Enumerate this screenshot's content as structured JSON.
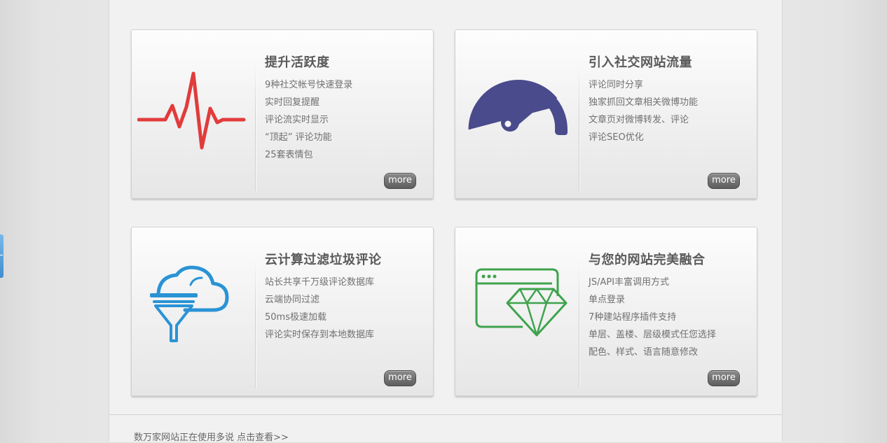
{
  "cards": [
    {
      "title": "提升活跃度",
      "items": [
        "9种社交帐号快速登录",
        "实时回复提醒",
        "评论流实时显示",
        "“顶起” 评论功能",
        "25套表情包"
      ],
      "more": "more",
      "icon": "heartbeat-icon",
      "icon_color": "#e23b3b"
    },
    {
      "title": "引入社交网站流量",
      "items": [
        "评论同时分享",
        "独家抓回文章相关微博功能",
        "文章页对微博转发、评论",
        "评论SEO优化"
      ],
      "more": "more",
      "icon": "speedometer-icon",
      "icon_color": "#4a4b8c"
    },
    {
      "title": "云计算过滤垃圾评论",
      "items": [
        "站长共享千万级评论数据库",
        "云端协同过滤",
        "50ms极速加载",
        "评论实时保存到本地数据库"
      ],
      "more": "more",
      "icon": "cloud-filter-icon",
      "icon_color": "#2a93d5"
    },
    {
      "title": "与您的网站完美融合",
      "items": [
        "JS/API丰富调用方式",
        "单点登录",
        "7种建站程序插件支持",
        "单层、盖楼、层级模式任您选择",
        "配色、样式、语言随意修改"
      ],
      "more": "more",
      "icon": "browser-diamond-icon",
      "icon_color": "#3fa34d"
    }
  ],
  "footer": {
    "text": "数万家网站正在使用多说 点击查看>>"
  }
}
